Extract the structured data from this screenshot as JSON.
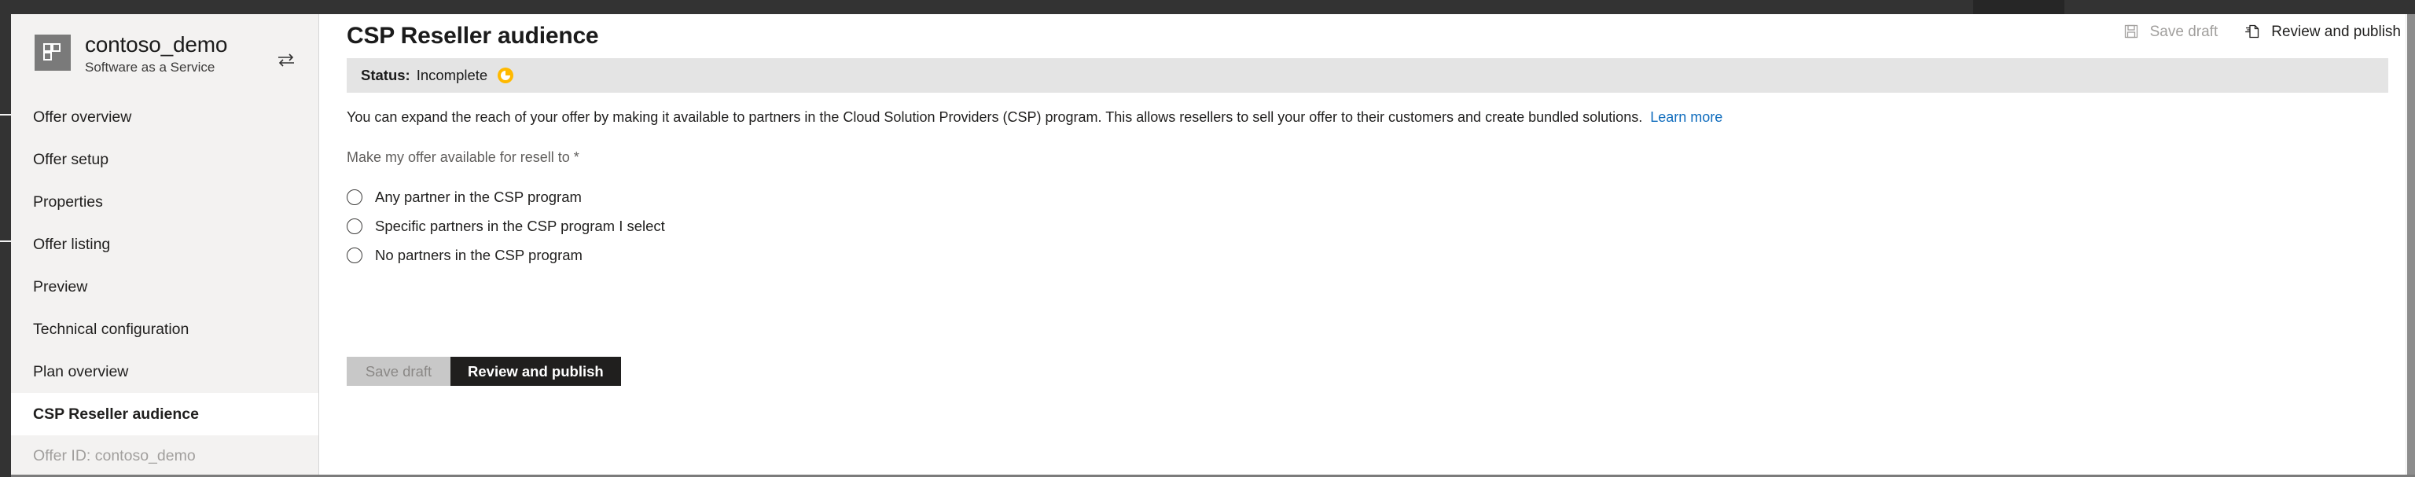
{
  "window": {
    "topbar_color": "#333333",
    "accent_link_color": "#0f6cbd",
    "status_icon_color": "#ffb900"
  },
  "sidebar": {
    "brand": {
      "icon": "app-grid-icon",
      "title": "contoso_demo",
      "subtitle": "Software as a Service",
      "switch_icon": "switch-offer-icon"
    },
    "items": [
      {
        "label": "Offer overview",
        "active": false
      },
      {
        "label": "Offer setup",
        "active": false
      },
      {
        "label": "Properties",
        "active": false
      },
      {
        "label": "Offer listing",
        "active": false
      },
      {
        "label": "Preview",
        "active": false
      },
      {
        "label": "Technical configuration",
        "active": false
      },
      {
        "label": "Plan overview",
        "active": false
      },
      {
        "label": "CSP Reseller audience",
        "active": true
      }
    ],
    "offer_id": "Offer ID: contoso_demo"
  },
  "header": {
    "title": "CSP Reseller audience",
    "actions": [
      {
        "label": "Save draft",
        "icon": "save-floppy-icon",
        "disabled": true
      },
      {
        "label": "Review and publish",
        "icon": "publish-page-icon",
        "disabled": false
      }
    ]
  },
  "status": {
    "label": "Status:",
    "value": "Incomplete",
    "icon": "in-progress-pie-icon"
  },
  "main": {
    "intro_text": "You can expand the reach of your offer by making it available to partners in the Cloud Solution Providers (CSP) program. This allows resellers to sell your offer to their customers and create bundled solutions.",
    "learn_more": "Learn more",
    "field_label": "Make my offer available for resell to *",
    "options": [
      {
        "label": "Any partner in the CSP program",
        "selected": false
      },
      {
        "label": "Specific partners in the CSP program I select",
        "selected": false
      },
      {
        "label": "No partners in the CSP program",
        "selected": false
      }
    ]
  },
  "footer": {
    "save_draft": "Save draft",
    "review_publish": "Review and publish"
  }
}
